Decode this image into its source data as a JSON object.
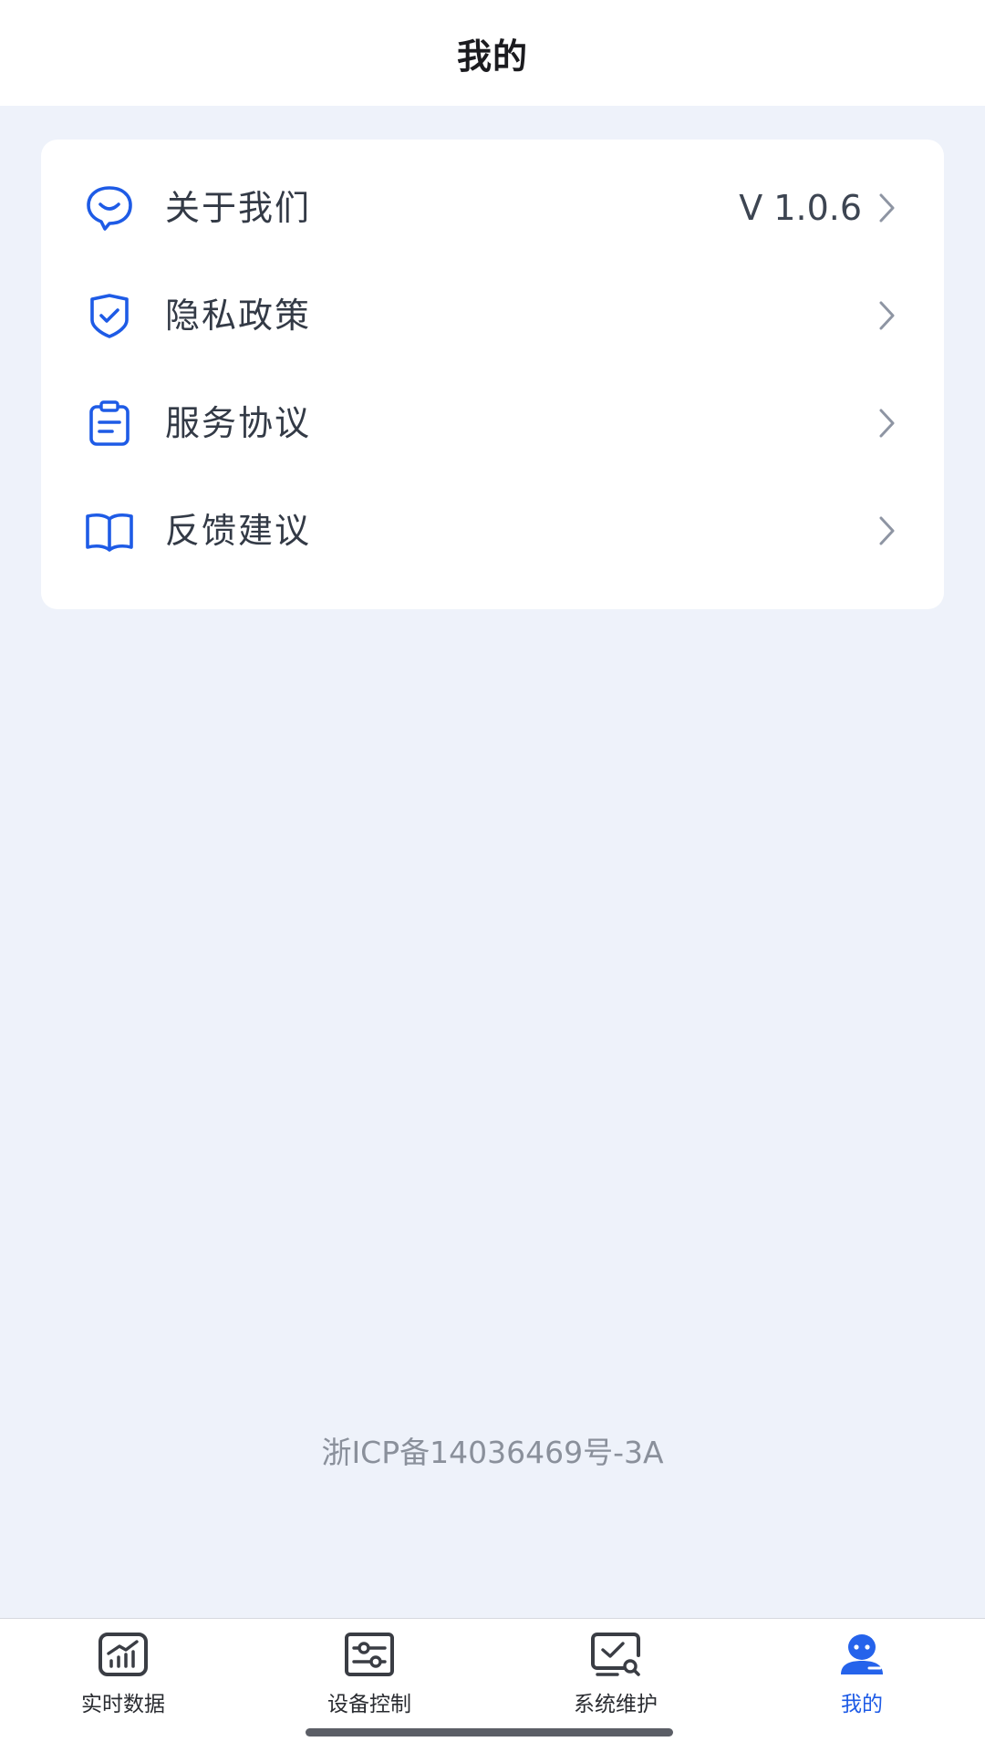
{
  "header": {
    "title": "我的"
  },
  "menu": {
    "items": [
      {
        "label": "关于我们",
        "value": "V 1.0.6",
        "icon": "chat-smile-icon"
      },
      {
        "label": "隐私政策",
        "value": "",
        "icon": "shield-check-icon"
      },
      {
        "label": "服务协议",
        "value": "",
        "icon": "clipboard-icon"
      },
      {
        "label": "反馈建议",
        "value": "",
        "icon": "open-book-icon"
      }
    ]
  },
  "footer": {
    "icp": "浙ICP备14036469号-3A"
  },
  "tabbar": {
    "tabs": [
      {
        "label": "实时数据",
        "icon": "chart-monitor-icon",
        "active": false
      },
      {
        "label": "设备控制",
        "icon": "sliders-icon",
        "active": false
      },
      {
        "label": "系统维护",
        "icon": "monitor-search-icon",
        "active": false
      },
      {
        "label": "我的",
        "icon": "user-icon",
        "active": true
      }
    ]
  },
  "colors": {
    "accent": "#1E5BE6",
    "background": "#EEF2FA",
    "card": "#FFFFFF",
    "text": "#333A46",
    "muted": "#8A909B"
  }
}
